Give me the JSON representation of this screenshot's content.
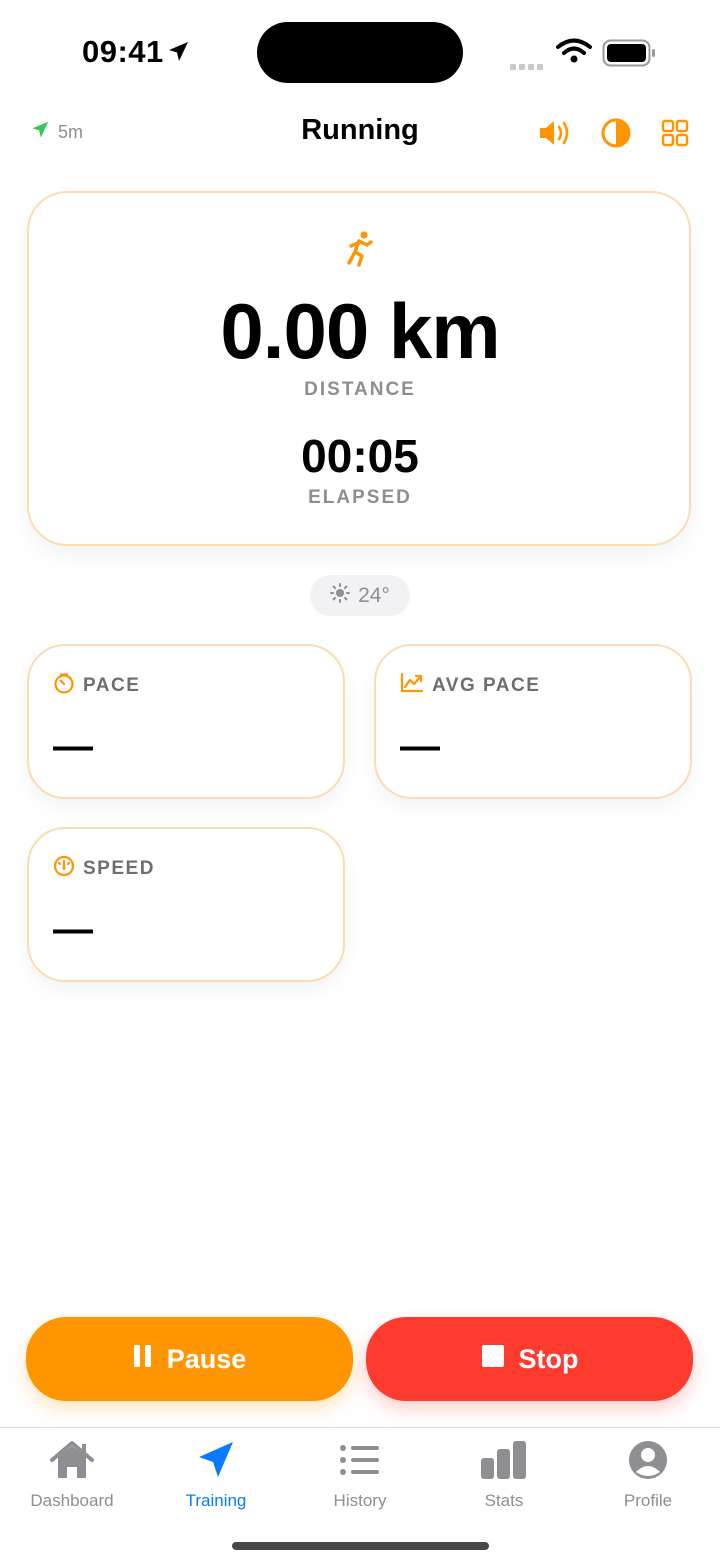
{
  "status_bar": {
    "time": "09:41"
  },
  "nav": {
    "gps_accuracy": "5m",
    "title": "Running",
    "icons": [
      "speaker-icon",
      "contrast-icon",
      "grid-icon"
    ]
  },
  "main_card": {
    "distance": "0.00 km",
    "distance_label": "DISTANCE",
    "elapsed": "00:05",
    "elapsed_label": "ELAPSED"
  },
  "weather": {
    "temperature": "24°",
    "icon": "sun-icon"
  },
  "metrics": [
    {
      "label": "PACE",
      "value": "—",
      "icon": "timer-icon"
    },
    {
      "label": "AVG PACE",
      "value": "—",
      "icon": "chart-icon"
    },
    {
      "label": "SPEED",
      "value": "—",
      "icon": "speedometer-icon"
    }
  ],
  "actions": {
    "pause": "Pause",
    "stop": "Stop"
  },
  "tabs": [
    {
      "label": "Dashboard",
      "icon": "house-icon",
      "active": false
    },
    {
      "label": "Training",
      "icon": "location-arrow-icon",
      "active": true
    },
    {
      "label": "History",
      "icon": "list-icon",
      "active": false
    },
    {
      "label": "Stats",
      "icon": "bar-chart-icon",
      "active": false
    },
    {
      "label": "Profile",
      "icon": "person-icon",
      "active": false
    }
  ],
  "colors": {
    "accent": "#ff9500",
    "stop": "#ff3b30",
    "tab_active": "#0a7aff",
    "gps": "#34c759",
    "card_border": "#fbdcae"
  }
}
